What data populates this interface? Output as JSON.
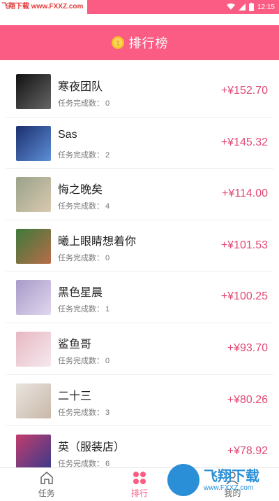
{
  "status_bar": {
    "watermark": "飞翔下载 www.FXXZ.com",
    "time": "12:15"
  },
  "header": {
    "title": "排行榜",
    "icon": "coin-icon"
  },
  "leaderboard": {
    "tasks_label": "任务完成数：",
    "rows": [
      {
        "name": "寒夜团队",
        "tasks": "0",
        "amount": "+¥152.70",
        "avatar_colors": [
          "#111111",
          "#666666"
        ]
      },
      {
        "name": "Sas",
        "tasks": "2",
        "amount": "+¥145.32",
        "avatar_colors": [
          "#1b2f6e",
          "#5d8fd6"
        ]
      },
      {
        "name": "悔之晚矣",
        "tasks": "4",
        "amount": "+¥114.00",
        "avatar_colors": [
          "#9aa28a",
          "#d9c9b0"
        ]
      },
      {
        "name": "曦上眼睛想着你",
        "tasks": "0",
        "amount": "+¥101.53",
        "avatar_colors": [
          "#3d7a3a",
          "#b86c4a"
        ]
      },
      {
        "name": "黑色星晨",
        "tasks": "1",
        "amount": "+¥100.25",
        "avatar_colors": [
          "#a89bc9",
          "#e0d6ee"
        ]
      },
      {
        "name": "鲨鱼哥",
        "tasks": "0",
        "amount": "+¥93.70",
        "avatar_colors": [
          "#e6b8c2",
          "#f6e8ee"
        ]
      },
      {
        "name": "二十三",
        "tasks": "3",
        "amount": "+¥80.26",
        "avatar_colors": [
          "#e9e4df",
          "#c9b8a8"
        ]
      },
      {
        "name": "英（服装店）",
        "tasks": "6",
        "amount": "+¥78.92",
        "avatar_colors": [
          "#c23d6e",
          "#3a3a8a"
        ]
      }
    ]
  },
  "tabbar": {
    "tabs": [
      {
        "label": "任务",
        "icon": "home-icon"
      },
      {
        "label": "排行",
        "icon": "ranking-icon"
      },
      {
        "label": "我的",
        "icon": "profile-icon"
      }
    ]
  },
  "overlay_watermark": {
    "big": "飞翔下载",
    "small": "www.FXXZ.com"
  },
  "colors": {
    "primary": "#fb5c84",
    "amount": "#e04a74"
  }
}
